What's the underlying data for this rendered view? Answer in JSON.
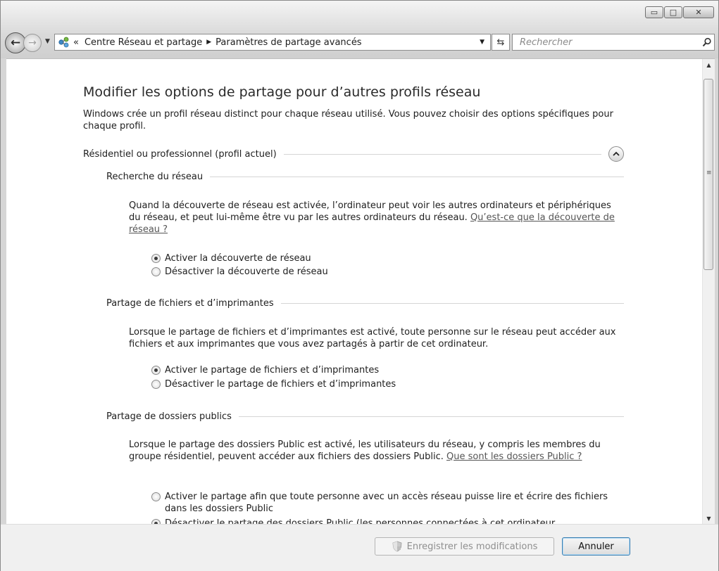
{
  "window": {
    "minimize_glyph": "▭",
    "maximize_glyph": "□",
    "close_glyph": "✕"
  },
  "nav": {
    "back_glyph": "←",
    "forward_glyph": "→",
    "history_glyph": "▼",
    "overflow": "«",
    "breadcrumbs": [
      "Centre Réseau et partage",
      "Paramètres de partage avancés"
    ],
    "separator": "▶",
    "address_dropdown_glyph": "▼",
    "refresh_glyph": "⇆",
    "search_placeholder": "Rechercher"
  },
  "page": {
    "title": "Modifier les options de partage pour d’autres profils réseau",
    "intro": "Windows crée un profil réseau distinct pour chaque réseau utilisé. Vous pouvez choisir des options spécifiques pour chaque profil.",
    "profile_label": "Résidentiel ou professionnel (profil actuel)",
    "sections": {
      "discovery": {
        "label": "Recherche du réseau",
        "text": "Quand la découverte de réseau est activée, l’ordinateur peut voir les autres ordinateurs et périphériques du réseau, et peut lui-même être vu par les autres ordinateurs du réseau. ",
        "link": "Qu’est-ce que la découverte de réseau ?",
        "opt_on": "Activer la découverte de réseau",
        "opt_off": "Désactiver la découverte de réseau"
      },
      "file_sharing": {
        "label": "Partage de fichiers et d’imprimantes",
        "text": "Lorsque le partage de fichiers et d’imprimantes est activé, toute personne sur le réseau peut accéder aux fichiers et aux imprimantes que vous avez partagés à partir de cet ordinateur.",
        "opt_on": "Activer le partage de fichiers et d’imprimantes",
        "opt_off": "Désactiver le partage de fichiers et d’imprimantes"
      },
      "public_folders": {
        "label": "Partage de dossiers publics",
        "text": "Lorsque le partage des dossiers Public est activé, les utilisateurs du réseau, y compris les membres du groupe résidentiel, peuvent accéder aux fichiers des dossiers Public. ",
        "link": "Que sont les dossiers Public ?",
        "opt_on": "Activer le partage afin que toute personne avec un accès réseau puisse lire et écrire des fichiers dans les dossiers Public",
        "opt_off": "Désactiver le partage des dossiers Public (les personnes connectées à cet ordinateur"
      }
    }
  },
  "footer": {
    "save_label": "Enregistrer les modifications",
    "cancel_label": "Annuler"
  }
}
